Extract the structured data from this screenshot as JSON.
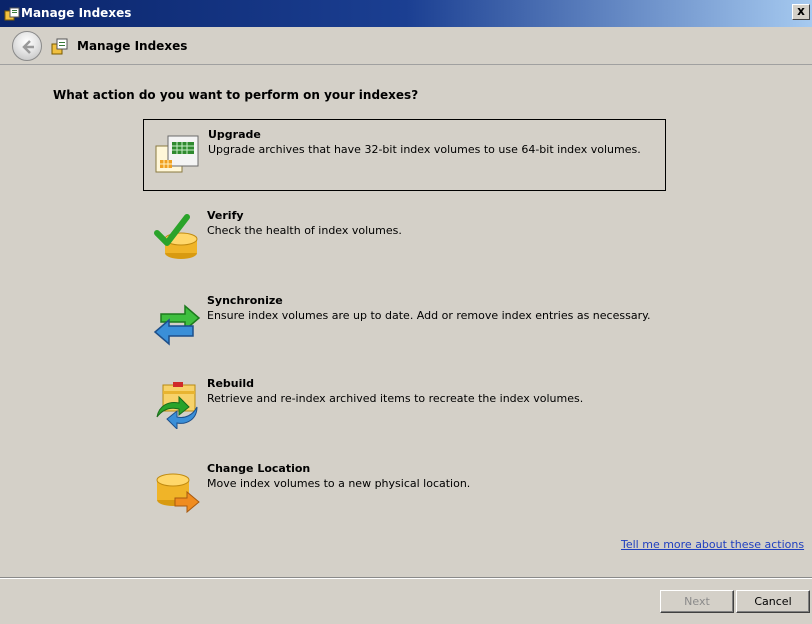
{
  "window": {
    "title": "Manage Indexes",
    "close_label": "x"
  },
  "nav": {
    "title": "Manage Indexes"
  },
  "question": "What action do you want to perform on your indexes?",
  "actions": [
    {
      "label": "Upgrade",
      "description": "Upgrade archives that have 32-bit index volumes to use 64-bit index volumes.",
      "icon": "upgrade-icon",
      "selected": true
    },
    {
      "label": "Verify",
      "description": "Check the health of index volumes.",
      "icon": "verify-icon"
    },
    {
      "label": "Synchronize",
      "description": "Ensure index volumes are up to date. Add or remove index entries as necessary.",
      "icon": "synchronize-icon"
    },
    {
      "label": "Rebuild",
      "description": "Retrieve and re-index archived items to recreate the index volumes.",
      "icon": "rebuild-icon"
    },
    {
      "label": "Change Location",
      "description": "Move index volumes to a new physical location.",
      "icon": "change-location-icon"
    }
  ],
  "help_link": "Tell me more about these actions",
  "buttons": {
    "next": "Next",
    "cancel": "Cancel"
  }
}
